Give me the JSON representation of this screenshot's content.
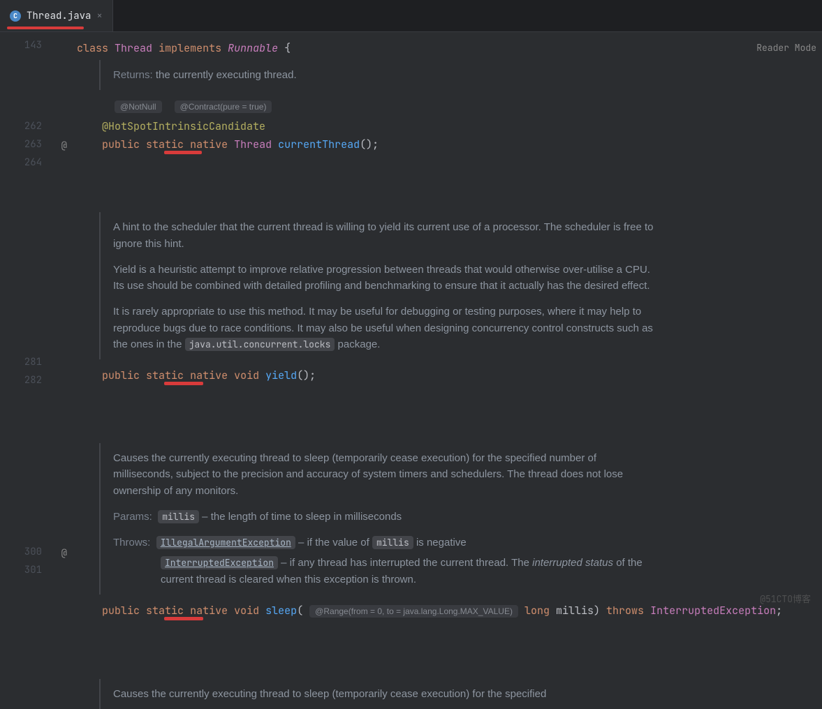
{
  "tab": {
    "label": "Thread.java",
    "icon": "C"
  },
  "readerMode": "Reader Mode",
  "watermark": "@51CTO博客",
  "gutter": {
    "l143": "143",
    "l262": "262",
    "l263": "263",
    "l264": "264",
    "l281": "281",
    "l282": "282",
    "l300": "300",
    "l301": "301",
    "atIcon": "@"
  },
  "sig": {
    "class_kw": "class",
    "class_name": "Thread",
    "implements_kw": "implements",
    "runnable": "Runnable",
    "brace": "{"
  },
  "doc1": {
    "returnsLabel": "Returns:",
    "returnsText": " the currently executing thread."
  },
  "inlay1": {
    "a": "@NotNull",
    "b": "@Contract(pure = true)"
  },
  "ann1": "@HotSpotIntrinsicCandidate",
  "m1": {
    "public": "public",
    "static": "static",
    "native": "native",
    "type": "Thread",
    "name": "currentThread",
    "tail": "();"
  },
  "doc2": {
    "p1": "A hint to the scheduler that the current thread is willing to yield its current use of a processor. The scheduler is free to ignore this hint.",
    "p2": "Yield is a heuristic attempt to improve relative progression between threads that would otherwise over-utilise a CPU. Its use should be combined with detailed profiling and benchmarking to ensure that it actually has the desired effect.",
    "p3a": "It is rarely appropriate to use this method. It may be useful for debugging or testing purposes, where it may help to reproduce bugs due to race conditions. It may also be useful when designing concurrency control constructs such as the ones in the ",
    "p3code": "java.util.concurrent.locks",
    "p3b": " package."
  },
  "m2": {
    "public": "public",
    "static": "static",
    "native": "native",
    "void": "void",
    "name": "yield",
    "tail": "();"
  },
  "doc3": {
    "p1": "Causes the currently executing thread to sleep (temporarily cease execution) for the specified number of milliseconds, subject to the precision and accuracy of system timers and schedulers. The thread does not lose ownership of any monitors.",
    "paramsLabel": "Params:",
    "paramsCode": "millis",
    "paramsText": " – the length of time to sleep in milliseconds",
    "throwsLabel": "Throws:",
    "t1": "IllegalArgumentException",
    "t1text_a": " – if the value of ",
    "t1code": "millis",
    "t1text_b": " is negative",
    "t2": "InterruptedException",
    "t2text_a": " – if any thread has interrupted the current thread. The ",
    "t2em": "interrupted status",
    "t2text_b": " of the current thread is cleared when this exception is thrown."
  },
  "m3": {
    "public": "public",
    "static": "static",
    "native": "native",
    "void": "void",
    "name": "sleep",
    "lp": "(",
    "inlay": "@Range(from = 0, to = java.lang.Long.MAX_VALUE)",
    "long": "long",
    "param": "millis",
    "rp": ")",
    "throws": "throws",
    "exc": "InterruptedException",
    "semi": ";"
  },
  "doc4": {
    "p1": "Causes the currently executing thread to sleep (temporarily cease execution) for the specified"
  }
}
